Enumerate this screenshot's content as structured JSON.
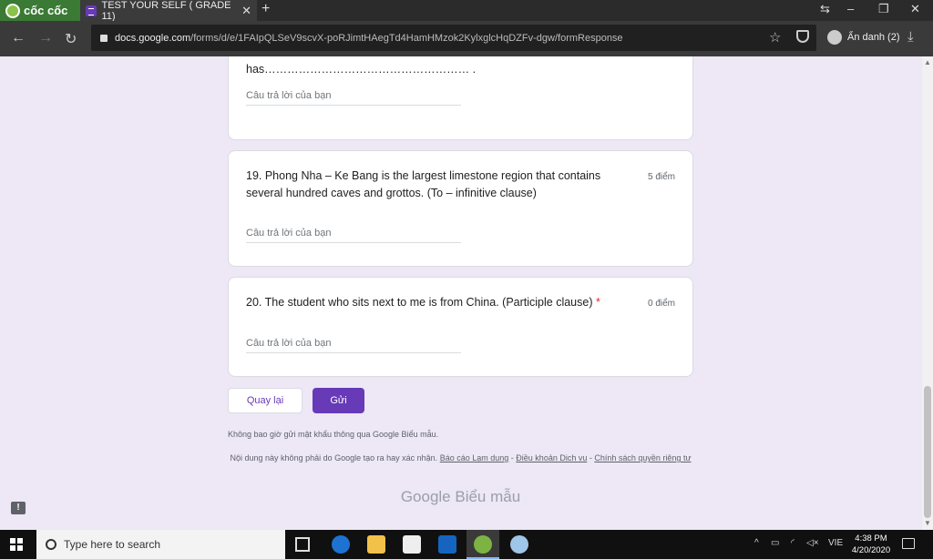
{
  "browser": {
    "brand": "cốc cốc",
    "tab_title": "TEST YOUR SELF ( GRADE 11)",
    "tab_close": "✕",
    "new_tab": "+",
    "url_host": "docs.google.com",
    "url_path": "/forms/d/e/1FAIpQLSeV9scvX-poRJimtHAegTd4HamHMzok2KylxglcHqDZFv-dgw/formResponse",
    "profile_label": "Ẩn danh (2)",
    "window_controls": [
      "⇆",
      "–",
      "❐",
      "✕"
    ]
  },
  "form": {
    "q18_tail": "has……………………………………………… .",
    "answer_placeholder": "Câu trả lời của bạn",
    "q19_text": "19. Phong Nha – Ke Bang is the largest limestone region that contains several hundred caves and grottos. (To – infinitive clause)",
    "q19_points": "5 điểm",
    "q20_text": "20. The student who sits next to me is from China. (Participle clause)",
    "q20_required": "*",
    "q20_points": "0 điểm",
    "back_button": "Quay lại",
    "submit_button": "Gửi",
    "never_password": "Không bao giờ gửi mật khẩu thông qua Google Biểu mẫu.",
    "disclaimer_text": "Nội dung này không phải do Google tạo ra hay xác nhận.",
    "disclaimer_link1": "Báo cáo Lạm dụng",
    "disclaimer_sep": "-",
    "disclaimer_link2": "Điều khoản Dịch vụ",
    "disclaimer_link3": "Chính sách quyền riêng tư",
    "footer_logo": "Google Biểu mẫu"
  },
  "taskbar": {
    "search_placeholder": "Type here to search",
    "language": "VIE",
    "time": "4:38 PM",
    "date": "4/20/2020",
    "icons": [
      "task-view-icon",
      "edge-icon",
      "file-explorer-icon",
      "store-icon",
      "mail-icon",
      "coccoc-icon",
      "paint-icon"
    ]
  },
  "colors": {
    "accent": "#673ab7",
    "page_bg": "#ede7f6",
    "required": "#d93025"
  }
}
